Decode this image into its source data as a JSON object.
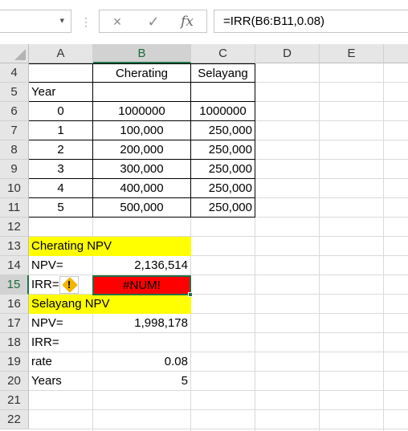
{
  "formula_bar": {
    "name_box": "",
    "cancel_icon": "×",
    "enter_icon": "✓",
    "fx_label": "fx",
    "formula": "=IRR(B6:B11,0.08)"
  },
  "columns": [
    "A",
    "B",
    "C",
    "D",
    "E"
  ],
  "selected_column": "B",
  "rows": [
    "4",
    "5",
    "6",
    "7",
    "8",
    "9",
    "10",
    "11",
    "12",
    "13",
    "14",
    "15",
    "16",
    "17",
    "18",
    "19",
    "20",
    "21",
    "22"
  ],
  "selected_row": "15",
  "cells": {
    "B4": "Cherating",
    "C4": "Selayang",
    "A5": "Year",
    "A6": "0",
    "B6": "1000000",
    "C6": "1000000",
    "A7": "1",
    "B7": "100,000",
    "C7": "250,000",
    "A8": "2",
    "B8": "200,000",
    "C8": "250,000",
    "A9": "3",
    "B9": "300,000",
    "C9": "250,000",
    "A10": "4",
    "B10": "400,000",
    "C10": "250,000",
    "A11": "5",
    "B11": "500,000",
    "C11": "250,000",
    "A13": "Cherating NPV",
    "A14": "NPV=",
    "B14": "2,136,514",
    "A15": "IRR=",
    "B15": "#NUM!",
    "A16": "Selayang NPV",
    "A17": "NPV=",
    "B17": "1,998,178",
    "A18": "IRR=",
    "A19": "rate",
    "B19": "0.08",
    "A20": "Years",
    "B20": "5"
  },
  "error_indicator": "!",
  "colors": {
    "highlight_yellow": "#ffff00",
    "error_red": "#ff0000",
    "selection_green": "#217346",
    "warning_amber": "#f2b600"
  }
}
